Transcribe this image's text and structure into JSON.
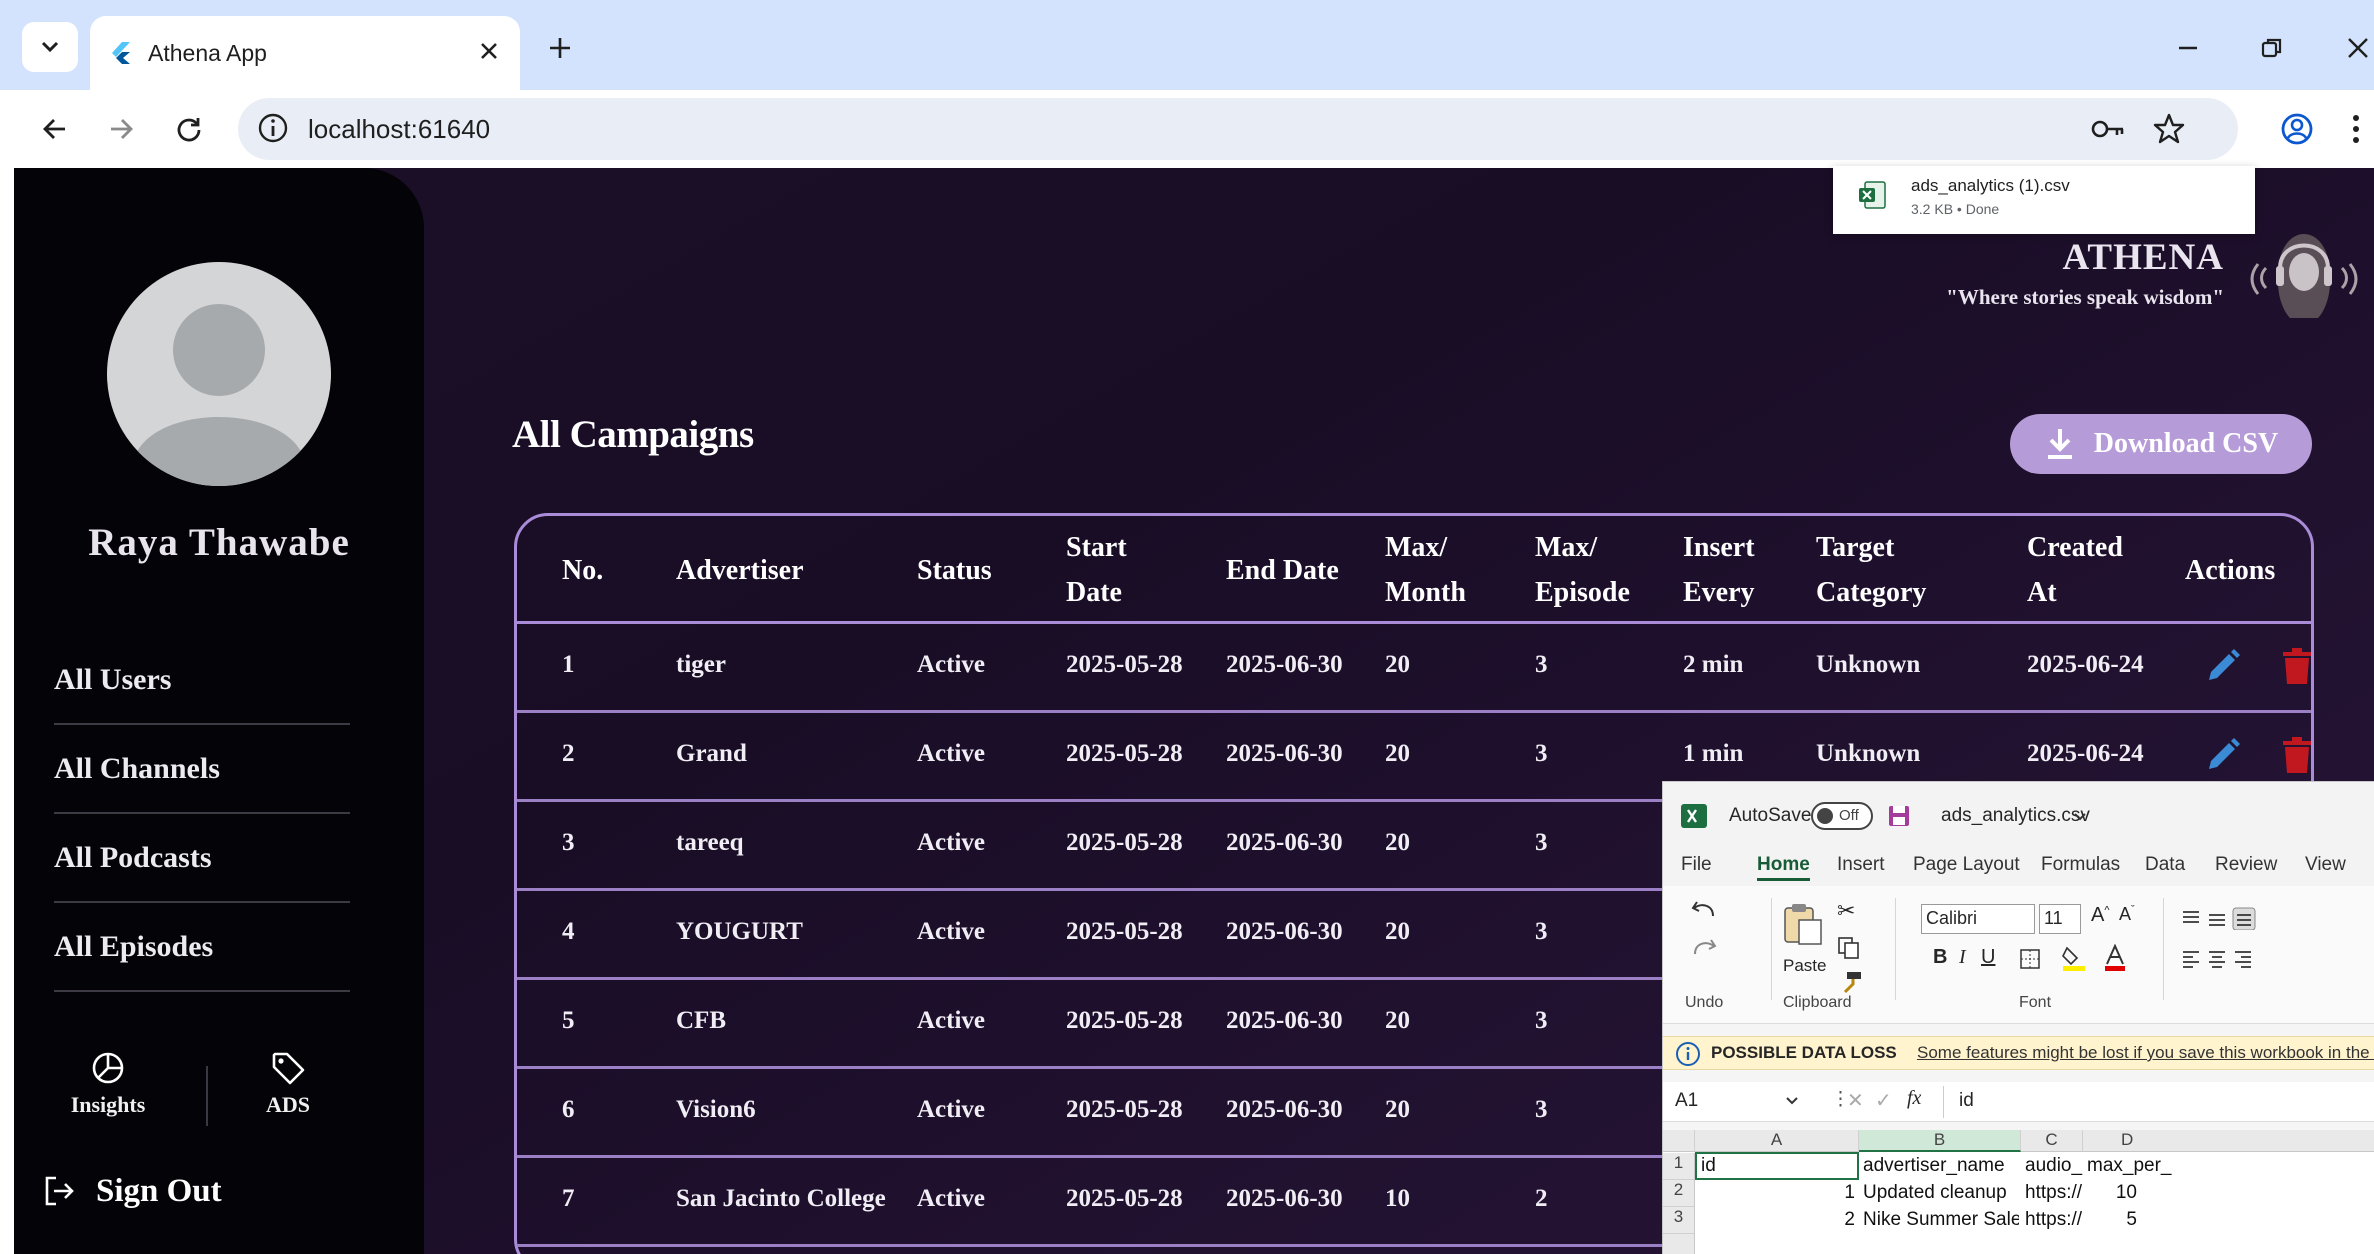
{
  "browser": {
    "tab_title": "Athena App",
    "url": "localhost:61640"
  },
  "download": {
    "filename": "ads_analytics (1).csv",
    "meta": "3.2 KB • Done"
  },
  "brand": {
    "name": "ATHENA",
    "tagline": "\"Where stories speak wisdom\""
  },
  "sidebar": {
    "username": "Raya Thawabe",
    "items": [
      {
        "label": "All Users"
      },
      {
        "label": "All Channels"
      },
      {
        "label": "All Podcasts"
      },
      {
        "label": "All Episodes"
      }
    ],
    "insights_label": "Insights",
    "ads_label": "ADS",
    "signout_label": "Sign Out"
  },
  "main": {
    "title": "All Campaigns",
    "download_label": "Download CSV",
    "headers": [
      {
        "line1": "No.",
        "line2": ""
      },
      {
        "line1": "Advertiser",
        "line2": ""
      },
      {
        "line1": "Status",
        "line2": ""
      },
      {
        "line1": "Start",
        "line2": "Date"
      },
      {
        "line1": "End Date",
        "line2": ""
      },
      {
        "line1": "Max/",
        "line2": "Month"
      },
      {
        "line1": "Max/",
        "line2": "Episode"
      },
      {
        "line1": "Insert",
        "line2": "Every"
      },
      {
        "line1": "Target",
        "line2": "Category"
      },
      {
        "line1": "Created",
        "line2": "At"
      },
      {
        "line1": "Actions",
        "line2": ""
      }
    ],
    "rows": [
      {
        "no": "1",
        "advertiser": "tiger",
        "status": "Active",
        "start": "2025-05-28",
        "end": "2025-06-30",
        "max_month": "20",
        "max_episode": "3",
        "insert_every": "2 min",
        "category": "Unknown",
        "created": "2025-06-24"
      },
      {
        "no": "2",
        "advertiser": "Grand",
        "status": "Active",
        "start": "2025-05-28",
        "end": "2025-06-30",
        "max_month": "20",
        "max_episode": "3",
        "insert_every": "1 min",
        "category": "Unknown",
        "created": "2025-06-24"
      },
      {
        "no": "3",
        "advertiser": "tareeq",
        "status": "Active",
        "start": "2025-05-28",
        "end": "2025-06-30",
        "max_month": "20",
        "max_episode": "3"
      },
      {
        "no": "4",
        "advertiser": "YOUGURT",
        "status": "Active",
        "start": "2025-05-28",
        "end": "2025-06-30",
        "max_month": "20",
        "max_episode": "3"
      },
      {
        "no": "5",
        "advertiser": "CFB",
        "status": "Active",
        "start": "2025-05-28",
        "end": "2025-06-30",
        "max_month": "20",
        "max_episode": "3"
      },
      {
        "no": "6",
        "advertiser": "Vision6",
        "status": "Active",
        "start": "2025-05-28",
        "end": "2025-06-30",
        "max_month": "20",
        "max_episode": "3"
      },
      {
        "no": "7",
        "advertiser": "San Jacinto College",
        "status": "Active",
        "start": "2025-05-28",
        "end": "2025-06-30",
        "max_month": "10",
        "max_episode": "2"
      }
    ]
  },
  "excel": {
    "autosave_label": "AutoSave",
    "autosave_state": "Off",
    "filename": "ads_analytics.csv",
    "menu": [
      "File",
      "Home",
      "Insert",
      "Page Layout",
      "Formulas",
      "Data",
      "Review",
      "View"
    ],
    "font_name": "Calibri",
    "font_size": "11",
    "paste_label": "Paste",
    "groups": [
      "Undo",
      "Clipboard",
      "Font"
    ],
    "warning_title": "POSSIBLE DATA LOSS",
    "warning_text": "Some features might be lost if you save this workbook in the c",
    "name_box": "A1",
    "formula": "id",
    "fx": "fx",
    "columns": [
      "A",
      "B",
      "C",
      "D"
    ],
    "rows": [
      {
        "n": "1",
        "a": "id",
        "b": "advertiser_name",
        "c": "audio_url",
        "d": "max_per_"
      },
      {
        "n": "2",
        "a": "1",
        "b": "Updated cleanup",
        "c": "https://re",
        "d": "10"
      },
      {
        "n": "3",
        "a": "2",
        "b": "Nike Summer Sale",
        "c": "https://re",
        "d": "5"
      }
    ]
  },
  "colors": {
    "accent": "#a98bd8",
    "button": "#b69bd9",
    "edit": "#3a8ad6",
    "delete": "#c0181e"
  }
}
